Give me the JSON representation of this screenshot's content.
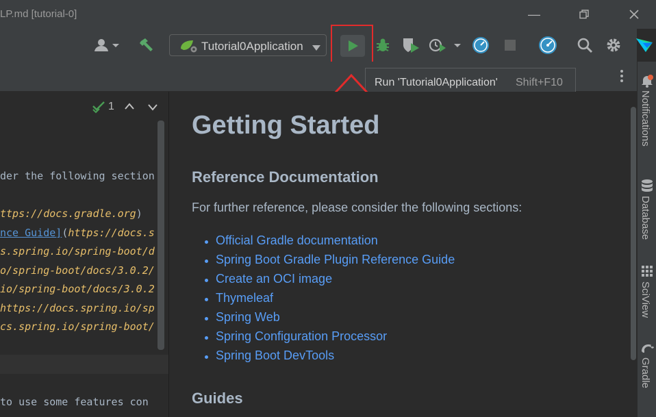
{
  "window": {
    "title": "LP.md [tutorial-0]",
    "controls": [
      "minimize",
      "restore",
      "close"
    ]
  },
  "toolbar": {
    "run_config": "Tutorial0Application",
    "icons": [
      "user-menu-icon",
      "build-hammer-icon",
      "run-icon",
      "debug-icon",
      "coverage-icon",
      "profile-icon",
      "profiler-gauge-icon",
      "stop-icon",
      "dashboard-icon",
      "search-icon",
      "settings-icon",
      "jetbrains-logo"
    ]
  },
  "tooltip": {
    "text": "Run 'Tutorial0Application'",
    "shortcut": "Shift+F10"
  },
  "editor": {
    "inspection_count": "1",
    "lines": [
      {
        "parts": [
          {
            "t": "der the following section",
            "c": "plain"
          }
        ]
      },
      {
        "parts": [
          {
            "t": "ttps://docs.gradle.org",
            "c": "url"
          },
          {
            "t": ")",
            "c": "plain"
          }
        ]
      },
      {
        "parts": [
          {
            "t": "nce Guide]",
            "c": "link"
          },
          {
            "t": "(",
            "c": "plain"
          },
          {
            "t": "https://docs.s",
            "c": "url"
          }
        ]
      },
      {
        "parts": [
          {
            "t": "s.spring.io/spring-boot/d",
            "c": "url"
          }
        ]
      },
      {
        "parts": [
          {
            "t": "o/spring-boot/docs/3.0.2/",
            "c": "url"
          }
        ]
      },
      {
        "parts": [
          {
            "t": "io/spring-boot/docs/3.0.2",
            "c": "url"
          }
        ]
      },
      {
        "parts": [
          {
            "t": "https://docs.spring.io/sp",
            "c": "url"
          }
        ]
      },
      {
        "parts": [
          {
            "t": "cs.spring.io/spring-boot/",
            "c": "url"
          }
        ]
      },
      {
        "parts": [
          {
            "t": " to use some features con",
            "c": "plain"
          }
        ]
      }
    ]
  },
  "preview": {
    "heading": "Getting Started",
    "section1": "Reference Documentation",
    "intro": "For further reference, please consider the following sections:",
    "links": [
      "Official Gradle documentation",
      "Spring Boot Gradle Plugin Reference Guide",
      "Create an OCI image",
      "Thymeleaf",
      "Spring Web",
      "Spring Configuration Processor",
      "Spring Boot DevTools"
    ],
    "section2": "Guides"
  },
  "right_panel": {
    "tools": [
      "Notifications",
      "Database",
      "SciView",
      "Gradle"
    ]
  },
  "colors": {
    "run_green": "#499c54",
    "highlight_red": "#e22b2b",
    "link_blue": "#589df6"
  }
}
